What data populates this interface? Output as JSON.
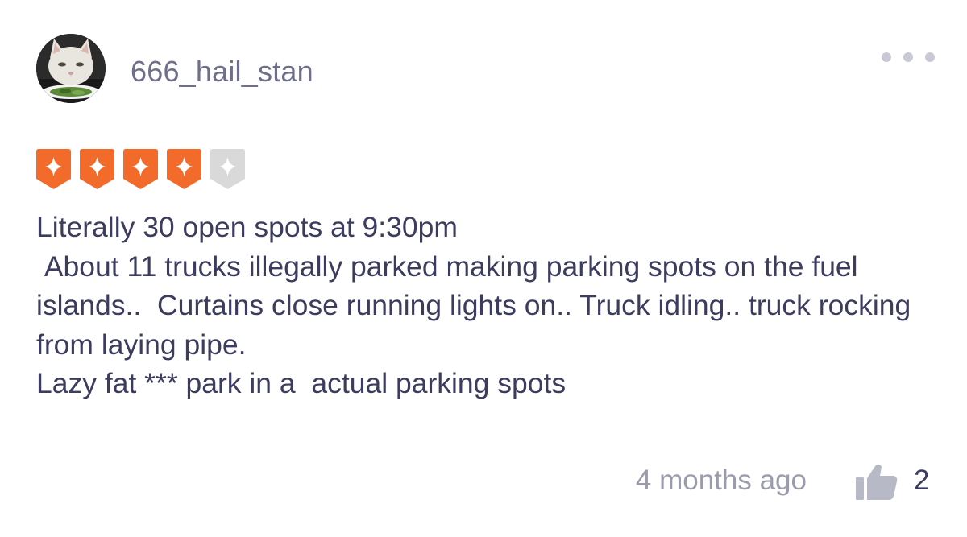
{
  "user": {
    "name": "666_hail_stan"
  },
  "rating": {
    "value": 4,
    "max": 5,
    "active_color": "#f26b2a",
    "inactive_color": "#d9d9d9"
  },
  "review": {
    "text": "Literally 30 open spots at 9:30pm\n About 11 trucks illegally parked making parking spots on the fuel islands..  Curtains close running lights on.. Truck idling.. truck rocking from laying pipe.\nLazy fat *** park in a  actual parking spots"
  },
  "footer": {
    "time": "4 months ago",
    "like_count": "2"
  },
  "icons": {
    "more": "more-horizontal-icon",
    "like": "thumbs-up-icon",
    "star": "star-badge-icon"
  }
}
